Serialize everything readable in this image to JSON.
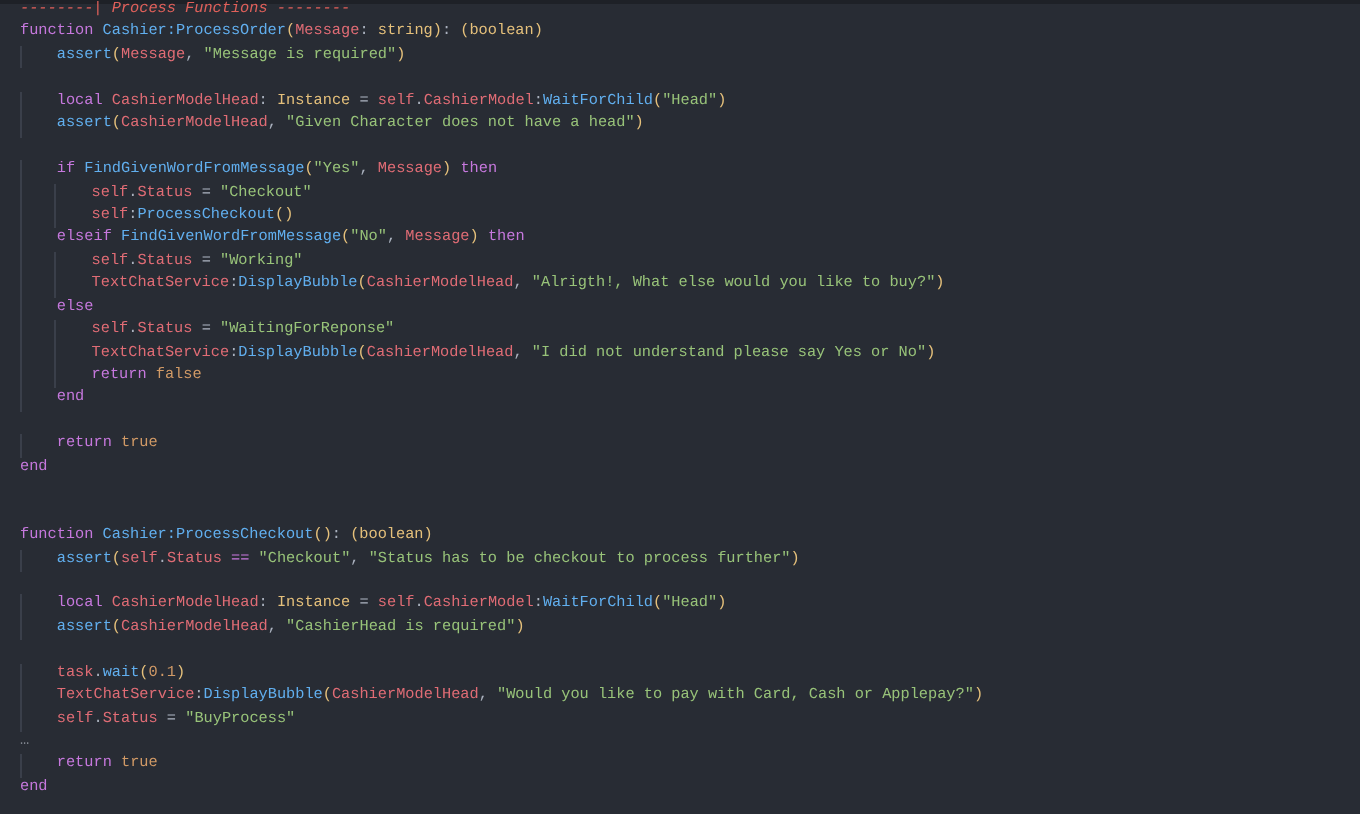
{
  "editor": {
    "lines": [
      {
        "kind": "code",
        "tokens": [
          {
            "kind": "comment",
            "text": "--------| Process Functions --------"
          }
        ]
      },
      {
        "kind": "code",
        "tokens": [
          {
            "kind": "kw",
            "text": "function"
          },
          {
            "kind": "fn",
            "text": " Cashier:ProcessOrder"
          },
          {
            "kind": "paren",
            "text": "("
          },
          {
            "kind": "var",
            "text": "Message"
          },
          {
            "kind": "plain",
            "text": ": "
          },
          {
            "kind": "type",
            "text": "string"
          },
          {
            "kind": "paren",
            "text": ")"
          },
          {
            "kind": "plain",
            "text": ": "
          },
          {
            "kind": "type",
            "text": "(boolean)"
          }
        ]
      },
      {
        "kind": "code",
        "tokens": [
          {
            "kind": "fn",
            "text": "    assert"
          },
          {
            "kind": "paren",
            "text": "("
          },
          {
            "kind": "var",
            "text": "Message"
          },
          {
            "kind": "plain",
            "text": ", "
          },
          {
            "kind": "str",
            "text": "\"Message is required\""
          },
          {
            "kind": "paren",
            "text": ")"
          }
        ]
      },
      {
        "kind": "blank"
      },
      {
        "kind": "code",
        "tokens": [
          {
            "kind": "kw",
            "text": "    local"
          },
          {
            "kind": "var",
            "text": " CashierModelHead"
          },
          {
            "kind": "plain",
            "text": ": "
          },
          {
            "kind": "type",
            "text": "Instance"
          },
          {
            "kind": "plain",
            "text": " = "
          },
          {
            "kind": "var",
            "text": "self"
          },
          {
            "kind": "plain",
            "text": "."
          },
          {
            "kind": "var",
            "text": "CashierModel"
          },
          {
            "kind": "plain",
            "text": ":"
          },
          {
            "kind": "fn",
            "text": "WaitForChild"
          },
          {
            "kind": "paren",
            "text": "("
          },
          {
            "kind": "str",
            "text": "\"Head\""
          },
          {
            "kind": "paren",
            "text": ")"
          }
        ]
      },
      {
        "kind": "code",
        "tokens": [
          {
            "kind": "fn",
            "text": "    assert"
          },
          {
            "kind": "paren",
            "text": "("
          },
          {
            "kind": "var",
            "text": "CashierModelHead"
          },
          {
            "kind": "plain",
            "text": ", "
          },
          {
            "kind": "str",
            "text": "\"Given Character does not have a head\""
          },
          {
            "kind": "paren",
            "text": ")"
          }
        ]
      },
      {
        "kind": "blank"
      },
      {
        "kind": "code",
        "tokens": [
          {
            "kind": "kw",
            "text": "    if"
          },
          {
            "kind": "fn",
            "text": " FindGivenWordFromMessage"
          },
          {
            "kind": "paren",
            "text": "("
          },
          {
            "kind": "str",
            "text": "\"Yes\""
          },
          {
            "kind": "plain",
            "text": ", "
          },
          {
            "kind": "var",
            "text": "Message"
          },
          {
            "kind": "paren",
            "text": ")"
          },
          {
            "kind": "kw",
            "text": " then"
          }
        ]
      },
      {
        "kind": "code",
        "tokens": [
          {
            "kind": "var",
            "text": "        self"
          },
          {
            "kind": "plain",
            "text": "."
          },
          {
            "kind": "var",
            "text": "Status"
          },
          {
            "kind": "plain",
            "text": " = "
          },
          {
            "kind": "str",
            "text": "\"Checkout\""
          }
        ]
      },
      {
        "kind": "code",
        "tokens": [
          {
            "kind": "var",
            "text": "        self"
          },
          {
            "kind": "plain",
            "text": ":"
          },
          {
            "kind": "fn",
            "text": "ProcessCheckout"
          },
          {
            "kind": "paren",
            "text": "()"
          }
        ]
      },
      {
        "kind": "code",
        "tokens": [
          {
            "kind": "kw",
            "text": "    elseif"
          },
          {
            "kind": "fn",
            "text": " FindGivenWordFromMessage"
          },
          {
            "kind": "paren",
            "text": "("
          },
          {
            "kind": "str",
            "text": "\"No\""
          },
          {
            "kind": "plain",
            "text": ", "
          },
          {
            "kind": "var",
            "text": "Message"
          },
          {
            "kind": "paren",
            "text": ")"
          },
          {
            "kind": "kw",
            "text": " then"
          }
        ]
      },
      {
        "kind": "code",
        "tokens": [
          {
            "kind": "var",
            "text": "        self"
          },
          {
            "kind": "plain",
            "text": "."
          },
          {
            "kind": "var",
            "text": "Status"
          },
          {
            "kind": "plain",
            "text": " = "
          },
          {
            "kind": "str",
            "text": "\"Working\""
          }
        ]
      },
      {
        "kind": "code",
        "tokens": [
          {
            "kind": "var",
            "text": "        TextChatService"
          },
          {
            "kind": "plain",
            "text": ":"
          },
          {
            "kind": "fn",
            "text": "DisplayBubble"
          },
          {
            "kind": "paren",
            "text": "("
          },
          {
            "kind": "var",
            "text": "CashierModelHead"
          },
          {
            "kind": "plain",
            "text": ", "
          },
          {
            "kind": "str",
            "text": "\"Alrigth!, What else would you like to buy?\""
          },
          {
            "kind": "paren",
            "text": ")"
          }
        ]
      },
      {
        "kind": "code",
        "tokens": [
          {
            "kind": "kw",
            "text": "    else"
          }
        ]
      },
      {
        "kind": "code",
        "tokens": [
          {
            "kind": "var",
            "text": "        self"
          },
          {
            "kind": "plain",
            "text": "."
          },
          {
            "kind": "var",
            "text": "Status"
          },
          {
            "kind": "plain",
            "text": " = "
          },
          {
            "kind": "str",
            "text": "\"WaitingForReponse\""
          }
        ]
      },
      {
        "kind": "code",
        "tokens": [
          {
            "kind": "var",
            "text": "        TextChatService"
          },
          {
            "kind": "plain",
            "text": ":"
          },
          {
            "kind": "fn",
            "text": "DisplayBubble"
          },
          {
            "kind": "paren",
            "text": "("
          },
          {
            "kind": "var",
            "text": "CashierModelHead"
          },
          {
            "kind": "plain",
            "text": ", "
          },
          {
            "kind": "str",
            "text": "\"I did not understand please say Yes or No\""
          },
          {
            "kind": "paren",
            "text": ")"
          }
        ]
      },
      {
        "kind": "code",
        "tokens": [
          {
            "kind": "kw",
            "text": "        return"
          },
          {
            "kind": "bool",
            "text": " false"
          }
        ]
      },
      {
        "kind": "code",
        "tokens": [
          {
            "kind": "kw",
            "text": "    end"
          }
        ]
      },
      {
        "kind": "blank"
      },
      {
        "kind": "code",
        "tokens": [
          {
            "kind": "kw",
            "text": "    return"
          },
          {
            "kind": "bool",
            "text": " true"
          }
        ]
      },
      {
        "kind": "code",
        "tokens": [
          {
            "kind": "kw",
            "text": "end"
          }
        ]
      },
      {
        "kind": "blank"
      },
      {
        "kind": "blank"
      },
      {
        "kind": "code",
        "tokens": [
          {
            "kind": "kw",
            "text": "function"
          },
          {
            "kind": "fn",
            "text": " Cashier:ProcessCheckout"
          },
          {
            "kind": "paren",
            "text": "()"
          },
          {
            "kind": "plain",
            "text": ": "
          },
          {
            "kind": "type",
            "text": "(boolean)"
          }
        ]
      },
      {
        "kind": "code",
        "tokens": [
          {
            "kind": "fn",
            "text": "    assert"
          },
          {
            "kind": "paren",
            "text": "("
          },
          {
            "kind": "var",
            "text": "self"
          },
          {
            "kind": "plain",
            "text": "."
          },
          {
            "kind": "var",
            "text": "Status"
          },
          {
            "kind": "kw",
            "text": " == "
          },
          {
            "kind": "str",
            "text": "\"Checkout\""
          },
          {
            "kind": "plain",
            "text": ", "
          },
          {
            "kind": "str",
            "text": "\"Status has to be checkout to process further\""
          },
          {
            "kind": "paren",
            "text": ")"
          }
        ]
      },
      {
        "kind": "blank"
      },
      {
        "kind": "code",
        "tokens": [
          {
            "kind": "kw",
            "text": "    local"
          },
          {
            "kind": "var",
            "text": " CashierModelHead"
          },
          {
            "kind": "plain",
            "text": ": "
          },
          {
            "kind": "type",
            "text": "Instance"
          },
          {
            "kind": "plain",
            "text": " = "
          },
          {
            "kind": "var",
            "text": "self"
          },
          {
            "kind": "plain",
            "text": "."
          },
          {
            "kind": "var",
            "text": "CashierModel"
          },
          {
            "kind": "plain",
            "text": ":"
          },
          {
            "kind": "fn",
            "text": "WaitForChild"
          },
          {
            "kind": "paren",
            "text": "("
          },
          {
            "kind": "str",
            "text": "\"Head\""
          },
          {
            "kind": "paren",
            "text": ")"
          }
        ]
      },
      {
        "kind": "code",
        "tokens": [
          {
            "kind": "fn",
            "text": "    assert"
          },
          {
            "kind": "paren",
            "text": "("
          },
          {
            "kind": "var",
            "text": "CashierModelHead"
          },
          {
            "kind": "plain",
            "text": ", "
          },
          {
            "kind": "str",
            "text": "\"CashierHead is required\""
          },
          {
            "kind": "paren",
            "text": ")"
          }
        ]
      },
      {
        "kind": "blank"
      },
      {
        "kind": "code",
        "tokens": [
          {
            "kind": "var",
            "text": "    task"
          },
          {
            "kind": "plain",
            "text": "."
          },
          {
            "kind": "fn",
            "text": "wait"
          },
          {
            "kind": "paren",
            "text": "("
          },
          {
            "kind": "bool",
            "text": "0.1"
          },
          {
            "kind": "paren",
            "text": ")"
          }
        ]
      },
      {
        "kind": "code",
        "tokens": [
          {
            "kind": "var",
            "text": "    TextChatService"
          },
          {
            "kind": "plain",
            "text": ":"
          },
          {
            "kind": "fn",
            "text": "DisplayBubble"
          },
          {
            "kind": "paren",
            "text": "("
          },
          {
            "kind": "var",
            "text": "CashierModelHead"
          },
          {
            "kind": "plain",
            "text": ", "
          },
          {
            "kind": "str",
            "text": "\"Would you like to pay with Card, Cash or Applepay?\""
          },
          {
            "kind": "paren",
            "text": ")"
          }
        ]
      },
      {
        "kind": "code",
        "tokens": [
          {
            "kind": "var",
            "text": "    self"
          },
          {
            "kind": "plain",
            "text": "."
          },
          {
            "kind": "var",
            "text": "Status"
          },
          {
            "kind": "plain",
            "text": " = "
          },
          {
            "kind": "str",
            "text": "\"BuyProcess\""
          }
        ]
      },
      {
        "kind": "code",
        "tokens": [
          {
            "kind": "fold",
            "text": "…"
          }
        ]
      },
      {
        "kind": "code",
        "tokens": [
          {
            "kind": "kw",
            "text": "    return"
          },
          {
            "kind": "bool",
            "text": " true"
          }
        ]
      },
      {
        "kind": "code",
        "tokens": [
          {
            "kind": "kw",
            "text": "end"
          }
        ]
      }
    ]
  }
}
